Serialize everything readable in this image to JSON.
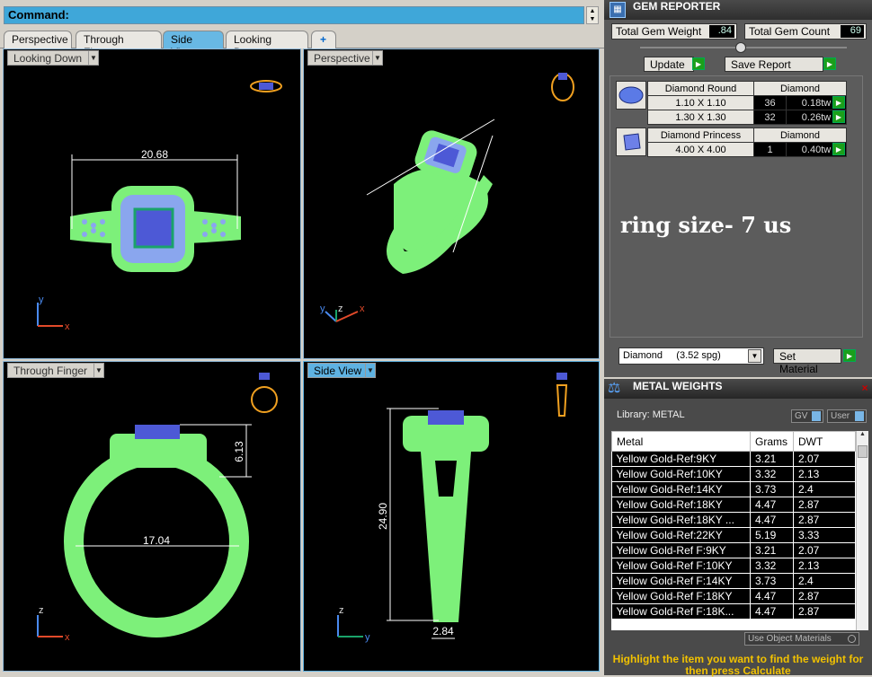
{
  "command": {
    "label": "Command:"
  },
  "tabs": [
    "Perspective",
    "Through Finger",
    "Side View",
    "Looking Down"
  ],
  "tab_add": "+",
  "viewports": {
    "top_left": {
      "label": "Looking Down",
      "dimension": "20.68",
      "axes": [
        "y",
        "x"
      ]
    },
    "top_right": {
      "label": "Perspective",
      "axes": [
        "y",
        "z",
        "x"
      ]
    },
    "bottom_left": {
      "label": "Through Finger",
      "dimension_h": "17.04",
      "dimension_v": "6.13",
      "axes": [
        "z",
        "x"
      ]
    },
    "bottom_right": {
      "label": "Side View",
      "dimension_v": "24.90",
      "dimension_h": "2.84",
      "axes": [
        "z",
        "y"
      ]
    }
  },
  "gem_reporter": {
    "title": "GEM REPORTER",
    "total_weight_label": "Total Gem Weight",
    "total_weight_value": ".84",
    "total_count_label": "Total Gem Count",
    "total_count_value": "69",
    "update_label": "Update",
    "save_report_label": "Save Report",
    "groups": [
      {
        "shape": "Diamond Round",
        "material": "Diamond",
        "rows": [
          {
            "size": "1.10 X 1.10",
            "count": "36",
            "tw": "0.18tw"
          },
          {
            "size": "1.30 X 1.30",
            "count": "32",
            "tw": "0.26tw"
          }
        ]
      },
      {
        "shape": "Diamond Princess",
        "material": "Diamond",
        "rows": [
          {
            "size": "4.00 X 4.00",
            "count": "1",
            "tw": "0.40tw"
          }
        ]
      }
    ],
    "note": "ring size- 7 us",
    "material_select": "Diamond     (3.52 spg)",
    "set_material_label": "Set Material"
  },
  "metal_weights": {
    "title": "METAL WEIGHTS",
    "library_label": "Library: METAL",
    "gv_label": "GV",
    "user_label": "User",
    "columns": [
      "Metal",
      "Grams",
      "DWT"
    ],
    "rows": [
      [
        "Yellow Gold-Ref:9KY",
        "3.21",
        "2.07"
      ],
      [
        "Yellow Gold-Ref:10KY",
        "3.32",
        "2.13"
      ],
      [
        "Yellow Gold-Ref:14KY",
        "3.73",
        "2.4"
      ],
      [
        "Yellow Gold-Ref:18KY",
        "4.47",
        "2.87"
      ],
      [
        "Yellow Gold-Ref:18KY ...",
        "4.47",
        "2.87"
      ],
      [
        "Yellow Gold-Ref:22KY",
        "5.19",
        "3.33"
      ],
      [
        "Yellow Gold-Ref F:9KY",
        "3.21",
        "2.07"
      ],
      [
        "Yellow Gold-Ref F:10KY",
        "3.32",
        "2.13"
      ],
      [
        "Yellow Gold-Ref F:14KY",
        "3.73",
        "2.4"
      ],
      [
        "Yellow Gold-Ref F:18KY",
        "4.47",
        "2.87"
      ],
      [
        "Yellow Gold-Ref F:18K...",
        "4.47",
        "2.87"
      ]
    ],
    "use_object_materials": "Use Object Materials",
    "hint": "Highlight the item you want to find the weight for then press Calculate"
  },
  "colors": {
    "ring_green": "#7df07a",
    "gem_blue": "#5b6ee0",
    "dim_line": "#ffffff",
    "accent_blue": "#5eb2e2"
  }
}
